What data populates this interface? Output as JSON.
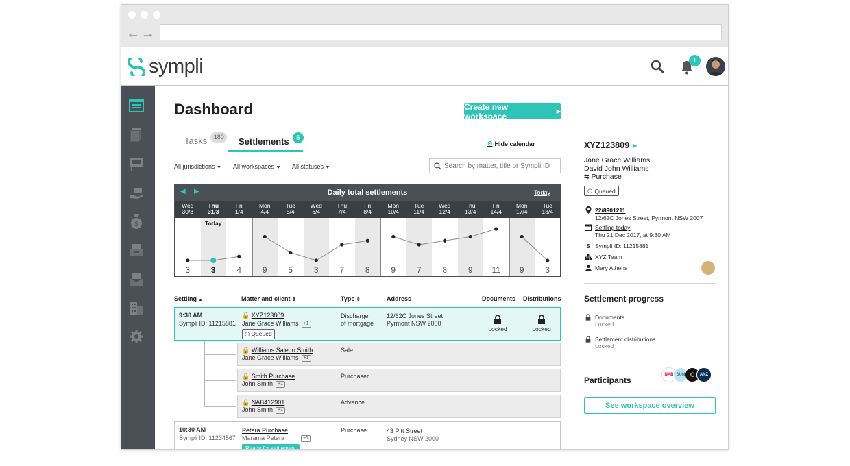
{
  "app": {
    "name": "sympli",
    "brand_color": "#2ec4b6",
    "notifications": "1"
  },
  "page": {
    "title": "Dashboard",
    "create_button": "Create new workspace",
    "hide_calendar": "Hide calendar"
  },
  "tabs": [
    {
      "label": "Tasks",
      "count": "180"
    },
    {
      "label": "Settlements",
      "count": "5"
    }
  ],
  "filters": {
    "jurisdictions": "All jurisdictions",
    "workspaces": "All workspaces",
    "statuses": "All statuses",
    "search_placeholder": "Search by matter, title or Sympli ID"
  },
  "calendar": {
    "title": "Daily total settlements",
    "today_link": "Today",
    "today_label": "Today",
    "days": [
      {
        "dow": "Wed",
        "date": "30/3",
        "count": "3",
        "value": 3
      },
      {
        "dow": "Thu",
        "date": "31/3",
        "count": "3",
        "value": 3,
        "today": true
      },
      {
        "dow": "Fri",
        "date": "1/4",
        "count": "4",
        "value": 4
      },
      {
        "dow": "Mon",
        "date": "4/4",
        "count": "9",
        "value": 9
      },
      {
        "dow": "Tue",
        "date": "5/4",
        "count": "5",
        "value": 5
      },
      {
        "dow": "Wed",
        "date": "6/4",
        "count": "3",
        "value": 3
      },
      {
        "dow": "Thu",
        "date": "7/4",
        "count": "7",
        "value": 7
      },
      {
        "dow": "Fri",
        "date": "8/4",
        "count": "8",
        "value": 8
      },
      {
        "dow": "Mon",
        "date": "10/4",
        "count": "9",
        "value": 9
      },
      {
        "dow": "Tue",
        "date": "11/4",
        "count": "7",
        "value": 7
      },
      {
        "dow": "Wed",
        "date": "12/4",
        "count": "8",
        "value": 8
      },
      {
        "dow": "Thu",
        "date": "13/4",
        "count": "9",
        "value": 9
      },
      {
        "dow": "Fri",
        "date": "14/4",
        "count": "11",
        "value": 11
      },
      {
        "dow": "Mon",
        "date": "17/4",
        "count": "9",
        "value": 9
      },
      {
        "dow": "Tue",
        "date": "18/4",
        "count": "3",
        "value": 3
      }
    ]
  },
  "table": {
    "headers": {
      "settling": "Settling",
      "matter": "Matter and client",
      "type": "Type",
      "address": "Address",
      "documents": "Documents",
      "distributions": "Distributions"
    },
    "main_row": {
      "time": "9:30 AM",
      "sympli_id": "Sympli ID: 11215881",
      "matter": "XYZ123809",
      "client": "Jane Grace Williams",
      "plus": "+1",
      "status": "Queued",
      "type_line1": "Discharge",
      "type_line2": "of mortgage",
      "address_line1": "12/62C Jones Street",
      "address_line2": "Pyrmont NSW 2000",
      "documents": "Locked",
      "distributions": "Locked"
    },
    "sub_rows": [
      {
        "matter": "Williams Sale to Smith",
        "client": "Jane Grace Williams",
        "plus": "+1",
        "type": "Sale"
      },
      {
        "matter": "Smith Purchase",
        "client": "John Smith",
        "plus": "+1",
        "type": "Purchaser"
      },
      {
        "matter": "NAB412901",
        "client": "John Smith",
        "plus": "+1",
        "type": "Advance"
      }
    ],
    "second_row": {
      "time": "10:30 AM",
      "sympli_id": "Sympli ID: 11234567",
      "matter": "Petera Purchase",
      "client": "Marama Petera",
      "plus": "+1",
      "status": "Ready for settlement",
      "type": "Purchase",
      "address_line1": "43 Pitt Street",
      "address_line2": "Sydney NSW 2000"
    }
  },
  "panel": {
    "id": "XYZ123809",
    "party1": "Jane Grace Williams",
    "party2": "David John Williams",
    "role": "Purchase",
    "status": "Queued",
    "title_ref": "22/8901211",
    "address": "12/62C Jones Street, Pyrmont NSW 2007",
    "settling_label": "Settling today",
    "settling_time": "Thu 21 Dec 2017, at 9:30 AM",
    "sympli_id": "Sympli ID: 11215881",
    "team": "XYZ Team",
    "person": "Mary Athens",
    "progress_title": "Settlement progress",
    "progress": [
      {
        "label": "Documents",
        "status": "Locked"
      },
      {
        "label": "Settlement distributions",
        "status": "Locked"
      }
    ],
    "participants_title": "Participants",
    "participant_logos": [
      "NAB",
      "SUN",
      "C",
      "ANZ"
    ],
    "overview_button": "See workspace overview"
  }
}
